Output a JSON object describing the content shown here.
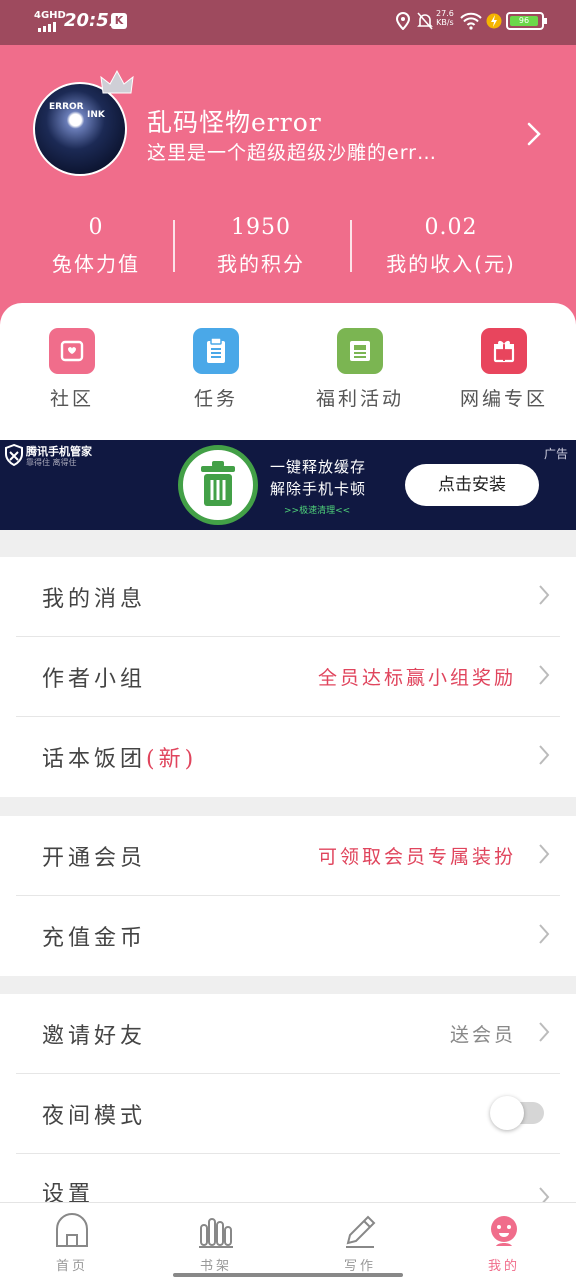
{
  "status_bar": {
    "network": "4GHD",
    "time": "20:51",
    "app_badge": "K",
    "speed_value": "27.6",
    "speed_unit": "KB/s",
    "battery_level": "96"
  },
  "profile": {
    "avatar_text_1": "ERROR",
    "avatar_text_2": "INK",
    "username": "乱码怪物error",
    "bio": "这里是一个超级超级沙雕的err…"
  },
  "stats": [
    {
      "value": "0",
      "label": "兔体力值"
    },
    {
      "value": "1950",
      "label": "我的积分"
    },
    {
      "value": "0.02",
      "label": "我的收入(元)"
    }
  ],
  "quick_actions": [
    {
      "label": "社区",
      "color": "#f06d8b"
    },
    {
      "label": "任务",
      "color": "#4aa8e8"
    },
    {
      "label": "福利活动",
      "color": "#7bb552"
    },
    {
      "label": "网编专区",
      "color": "#e8455d"
    }
  ],
  "ad": {
    "brand": "腾讯手机管家",
    "brand_sub": "靠得住 离得住",
    "tag": "广告",
    "line1": "一键释放缓存",
    "line2": "解除手机卡顿",
    "line3": ">>极速清理<<",
    "button": "点击安装"
  },
  "menu_group_1": {
    "messages": "我的消息",
    "author_group": "作者小组",
    "author_group_note": "全员达标赢小组奖励",
    "fan_club": "话本饭团",
    "fan_club_badge": "(新)"
  },
  "menu_group_2": {
    "vip": "开通会员",
    "vip_note": "可领取会员专属装扮",
    "recharge": "充值金币"
  },
  "menu_group_3": {
    "invite": "邀请好友",
    "invite_note": "送会员",
    "night_mode": "夜间模式",
    "night_mode_on": false,
    "settings": "设置"
  },
  "bottom_nav": [
    {
      "label": "首页",
      "active": false
    },
    {
      "label": "书架",
      "active": false
    },
    {
      "label": "写作",
      "active": false
    },
    {
      "label": "我的",
      "active": true
    }
  ],
  "colors": {
    "brand_pink": "#f06d8b",
    "accent_red": "#e0455d",
    "ad_navy": "#101841"
  }
}
